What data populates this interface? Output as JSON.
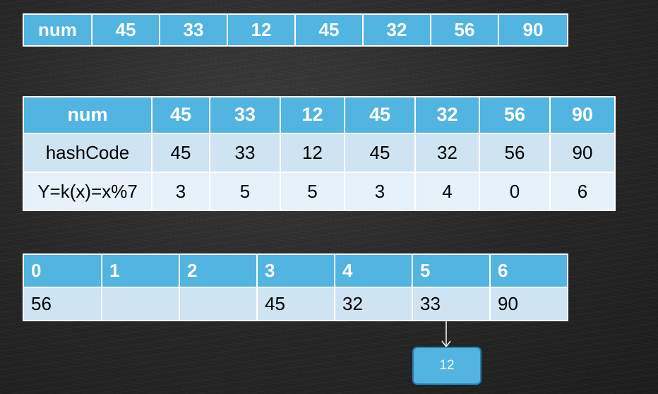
{
  "table_num": {
    "header": "num",
    "values": [
      "45",
      "33",
      "12",
      "45",
      "32",
      "56",
      "90"
    ]
  },
  "table_hash": {
    "header_row": [
      "num",
      "45",
      "33",
      "12",
      "45",
      "32",
      "56",
      "90"
    ],
    "hash_row": [
      "hashCode",
      "45",
      "33",
      "12",
      "45",
      "32",
      "56",
      "90"
    ],
    "mod_row": [
      "Y=k(x)=x%7",
      "3",
      "5",
      "5",
      "3",
      "4",
      "0",
      "6"
    ]
  },
  "table_buckets": {
    "indices": [
      "0",
      "1",
      "2",
      "3",
      "4",
      "5",
      "6"
    ],
    "values": [
      "56",
      "",
      "",
      "45",
      "32",
      "33",
      "90"
    ]
  },
  "chain_node": {
    "label": "12"
  },
  "colors": {
    "header_blue": "#52b4e0",
    "row_light": "#cee4f2",
    "row_lighter": "#e6f1f9"
  }
}
